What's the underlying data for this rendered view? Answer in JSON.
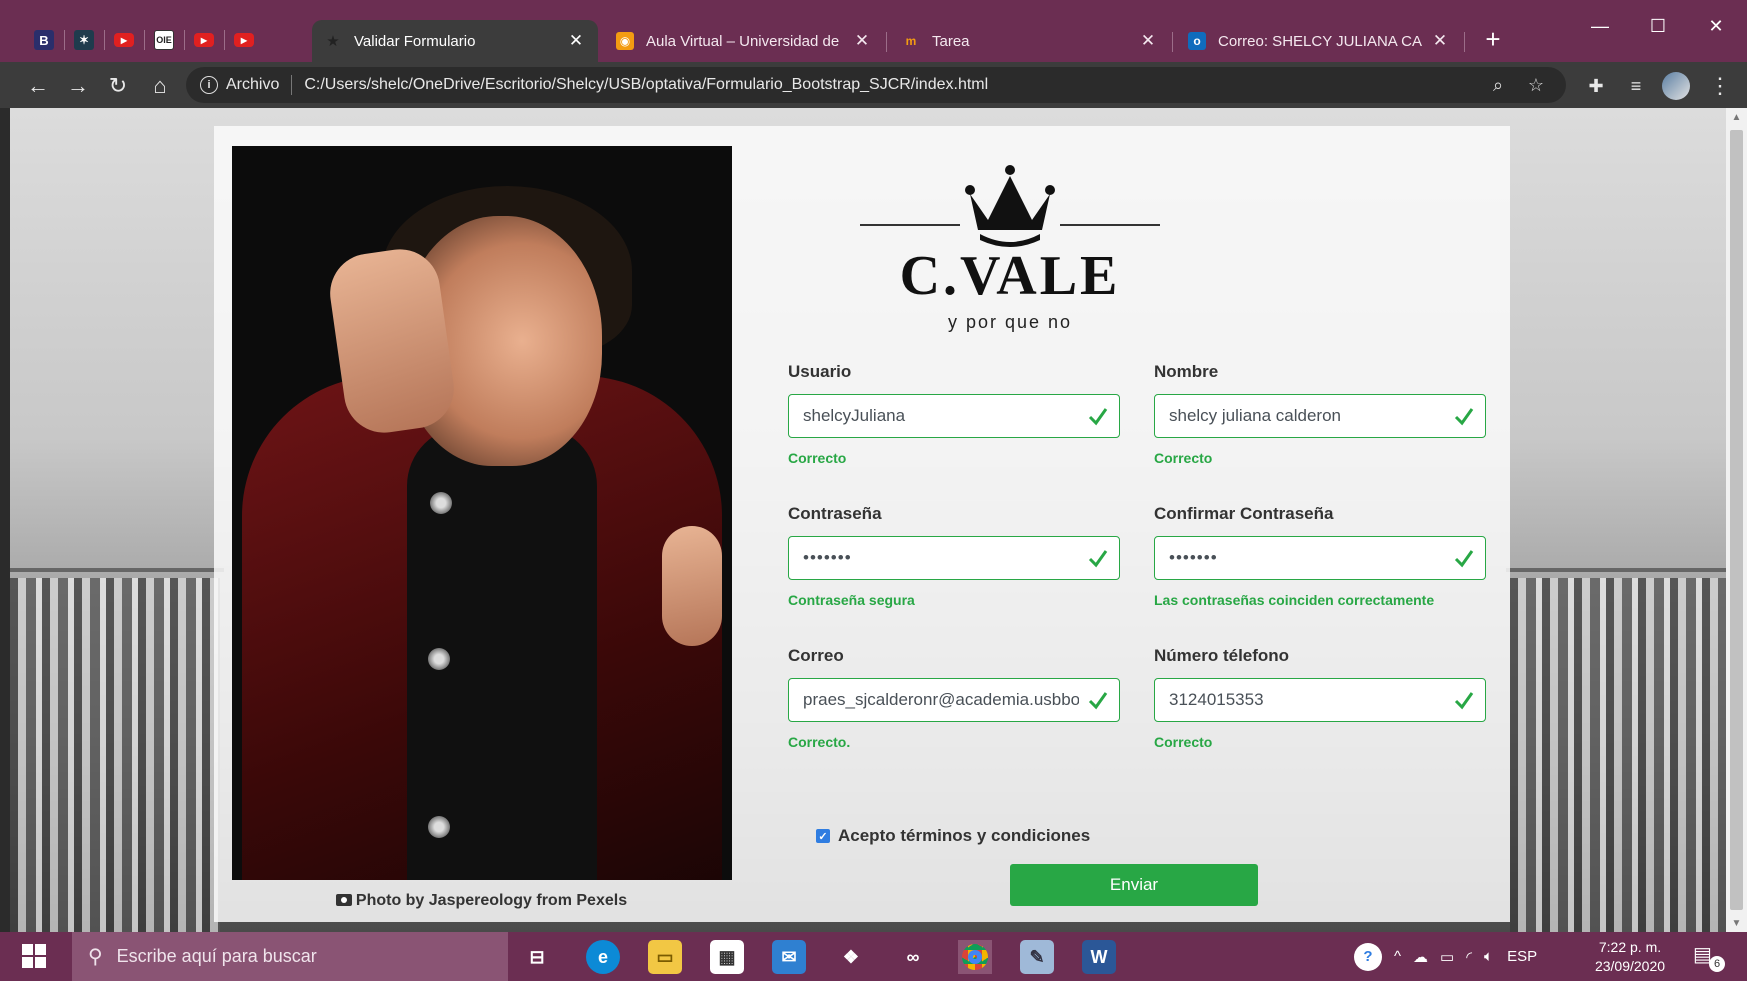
{
  "browser": {
    "pinned_tabs": [
      {
        "icon": "b-icon",
        "glyph": "B"
      },
      {
        "icon": "star-app-icon",
        "glyph": "✶"
      },
      {
        "icon": "youtube-icon",
        "glyph": "▶"
      },
      {
        "icon": "oie-icon",
        "glyph": "OIE"
      },
      {
        "icon": "youtube-icon",
        "glyph": "▶"
      },
      {
        "icon": "youtube-icon",
        "glyph": "▶"
      }
    ],
    "tabs": [
      {
        "title": "Validar Formulario",
        "active": true,
        "icon": "star-icon"
      },
      {
        "title": "Aula Virtual – Universidad de S",
        "active": false,
        "icon": "moodle-icon"
      },
      {
        "title": "Tarea",
        "active": false,
        "icon": "moodle-m-icon"
      },
      {
        "title": "Correo: SHELCY JULIANA CALD",
        "active": false,
        "icon": "outlook-icon"
      }
    ],
    "address": {
      "scheme_label": "Archivo",
      "url": "C:/Users/shelc/OneDrive/Escritorio/Shelcy/USB/optativa/Formulario_Bootstrap_SJCR/index.html"
    }
  },
  "page": {
    "photo_credit": "Photo by Jaspereology from Pexels",
    "logo": {
      "brand": "C.VALE",
      "tagline": "y por que no"
    },
    "fields": {
      "usuario": {
        "label": "Usuario",
        "value": "shelcyJuliana",
        "feedback": "Correcto"
      },
      "nombre": {
        "label": "Nombre",
        "value": "shelcy juliana calderon",
        "feedback": "Correcto"
      },
      "contrasena": {
        "label": "Contraseña",
        "value": "•••••••",
        "feedback": "Contraseña segura"
      },
      "confirmar": {
        "label": "Confirmar Contraseña",
        "value": "•••••••",
        "feedback": "Las contraseñas coinciden correctamente"
      },
      "correo": {
        "label": "Correo",
        "value": "praes_sjcalderonr@academia.usbbog.edu.co",
        "feedback": "Correcto."
      },
      "telefono": {
        "label": "Número télefono",
        "value": "3124015353",
        "feedback": "Correcto"
      }
    },
    "terms_label": "Acepto términos y condiciones",
    "terms_checked": true,
    "submit_label": "Enviar"
  },
  "taskbar": {
    "search_placeholder": "Escribe aquí para buscar",
    "language": "ESP",
    "time": "7:22 p. m.",
    "date": "23/09/2020",
    "notification_count": "6"
  },
  "colors": {
    "chrome_frame": "#6b2e52",
    "toolbar": "#3c3c3c",
    "success": "#28a745",
    "checkbox": "#2f7de1"
  }
}
